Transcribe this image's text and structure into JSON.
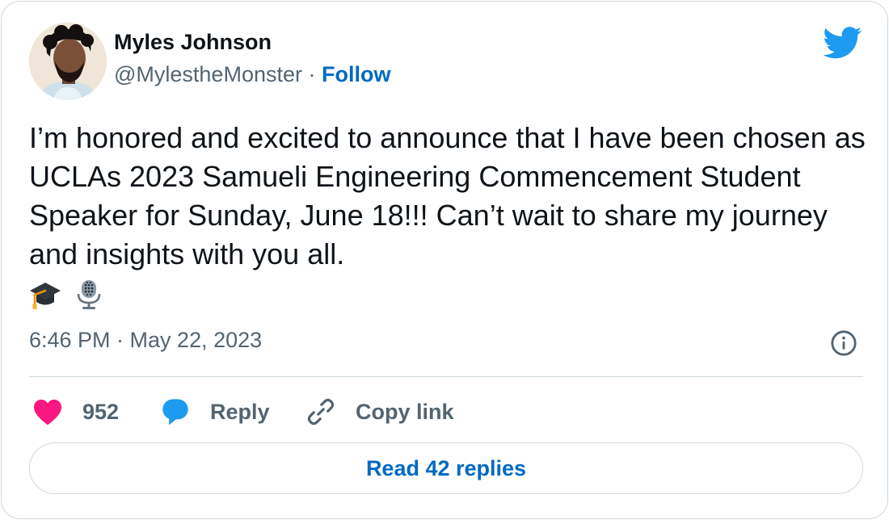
{
  "author": {
    "name": "Myles Johnson",
    "handle": "@MylestheMonster",
    "separator": "·",
    "follow_label": "Follow"
  },
  "tweet": {
    "text": "I’m honored and excited to announce that I have been chosen as UCLAs 2023 Samueli Engineering Commencement Student Speaker for Sunday, June 18!!! Can’t wait to share my journey and insights with you all.",
    "emojis": [
      "graduation-cap-icon",
      "microphone-icon"
    ],
    "timestamp": "6:46 PM · May 22, 2023"
  },
  "actions": {
    "likes_count": "952",
    "reply_label": "Reply",
    "copy_link_label": "Copy link",
    "read_replies_label": "Read 42 replies"
  },
  "colors": {
    "link_blue": "#0069c2",
    "twitter_blue": "#1d9bf0",
    "like_pink": "#f91880",
    "muted_text": "#536471",
    "border": "#cfd9de"
  }
}
